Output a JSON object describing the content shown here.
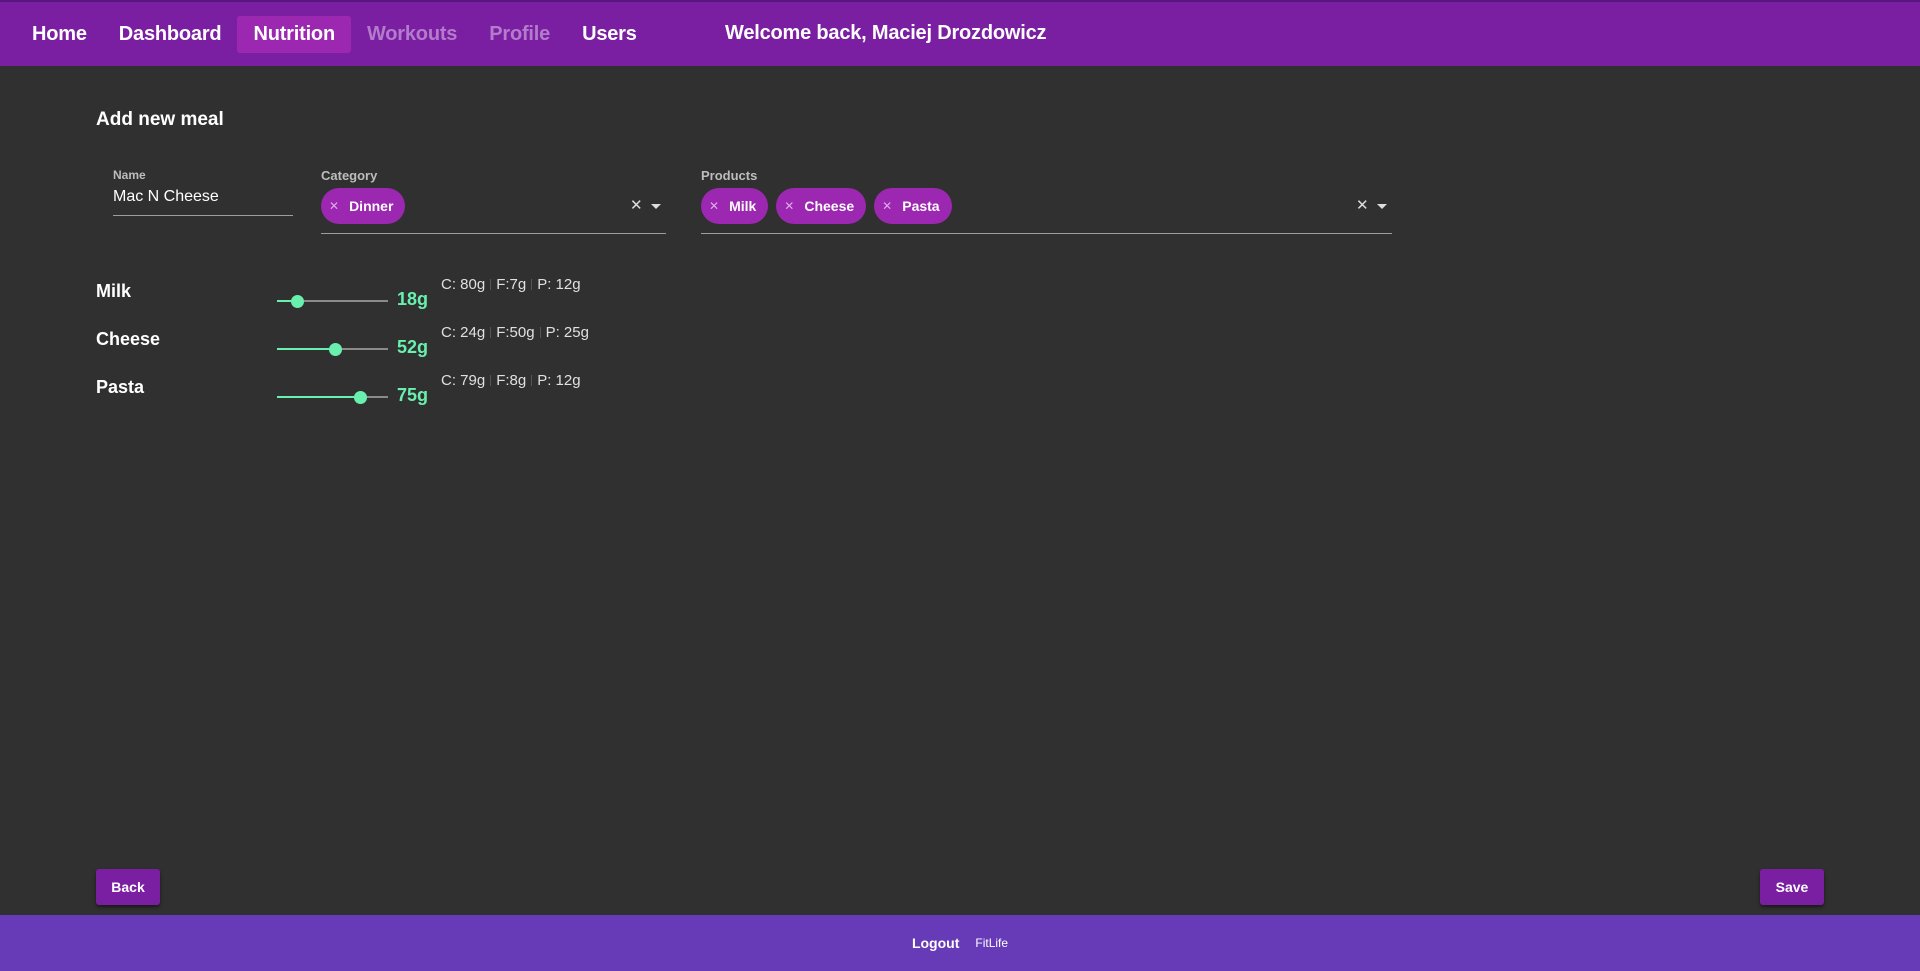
{
  "nav": {
    "items": [
      {
        "label": "Home",
        "state": "normal"
      },
      {
        "label": "Dashboard",
        "state": "normal"
      },
      {
        "label": "Nutrition",
        "state": "active"
      },
      {
        "label": "Workouts",
        "state": "disabled"
      },
      {
        "label": "Profile",
        "state": "disabled"
      },
      {
        "label": "Users",
        "state": "normal"
      }
    ],
    "welcome": "Welcome back, Maciej Drozdowicz"
  },
  "form": {
    "title": "Add new meal",
    "name": {
      "label": "Name",
      "value": "Mac N Cheese"
    },
    "category": {
      "label": "Category",
      "chips": [
        "Dinner"
      ]
    },
    "products": {
      "label": "Products",
      "chips": [
        "Milk",
        "Cheese",
        "Pasta"
      ]
    }
  },
  "product_rows": [
    {
      "name": "Milk",
      "amount": "18g",
      "slider_fraction": 0.18,
      "macros": [
        "C: 80g",
        "F:7g",
        "P: 12g"
      ]
    },
    {
      "name": "Cheese",
      "amount": "52g",
      "slider_fraction": 0.52,
      "macros": [
        "C: 24g",
        "F:50g",
        "P: 25g"
      ]
    },
    {
      "name": "Pasta",
      "amount": "75g",
      "slider_fraction": 0.75,
      "macros": [
        "C: 79g",
        "F:8g",
        "P: 12g"
      ]
    }
  ],
  "buttons": {
    "back": "Back",
    "save": "Save"
  },
  "footer": {
    "logout": "Logout",
    "brand": "FitLife"
  },
  "colors": {
    "header": "#7b1fa2",
    "accent": "#9c27b0",
    "slider": "#69f0ae",
    "footer": "#673ab7",
    "background": "#303030"
  }
}
